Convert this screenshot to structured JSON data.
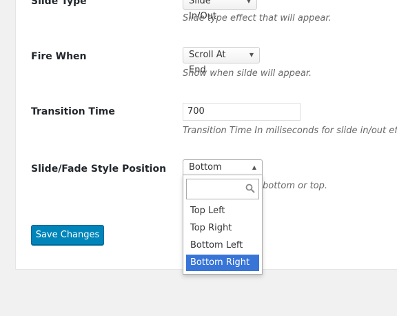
{
  "settings": {
    "slide_type": {
      "label": "Slide Type",
      "value": "Slide In/Out",
      "description": "Slide type effect that will appear."
    },
    "fire_when": {
      "label": "Fire When",
      "value": "Scroll At End",
      "description": "Show when silde will appear."
    },
    "transition_time": {
      "label": "Transition Time",
      "value": "700",
      "description": "Transition Time In miliseconds for slide in/out effec"
    },
    "position": {
      "label": "Slide/Fade Style Position",
      "value": "Bottom Right",
      "description_fragment": "bottom or top.",
      "search_value": "",
      "options": [
        "Top Left",
        "Top Right",
        "Bottom Left",
        "Bottom Right"
      ],
      "selected_option": "Bottom Right"
    }
  },
  "actions": {
    "save_label": "Save Changes"
  },
  "colors": {
    "primary_button": "#0085ba",
    "highlight": "#3875d7"
  }
}
